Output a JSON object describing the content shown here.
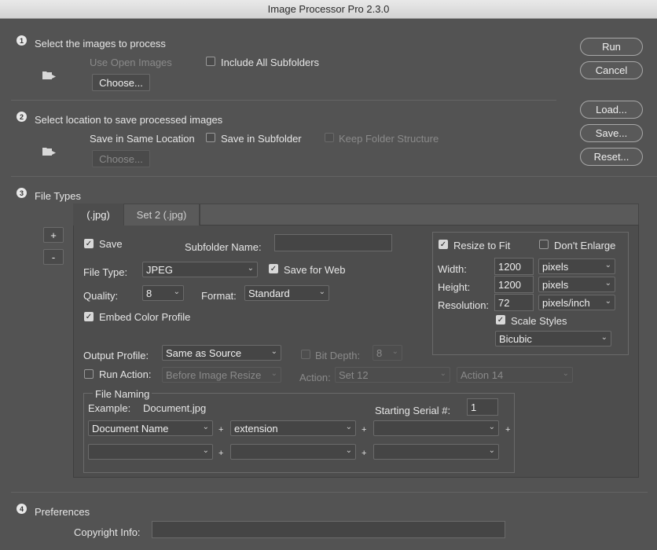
{
  "window": {
    "title": "Image Processor Pro 2.3.0"
  },
  "section1": {
    "num": "1",
    "title": "Select the images to process",
    "use_open_images": "Use Open Images",
    "include_subfolders": "Include All Subfolders",
    "choose": "Choose..."
  },
  "section2": {
    "num": "2",
    "title": "Select location to save processed images",
    "same_location": "Save in Same Location",
    "save_in_subfolder": "Save in Subfolder",
    "keep_structure": "Keep Folder Structure",
    "choose": "Choose..."
  },
  "buttons": {
    "run": "Run",
    "cancel": "Cancel",
    "load": "Load...",
    "save": "Save...",
    "reset": "Reset..."
  },
  "section3": {
    "num": "3",
    "title": "File Types",
    "plus": "+",
    "minus": "-",
    "tabs": [
      {
        "label": "(.jpg)"
      },
      {
        "label": "Set 2 (.jpg)"
      }
    ],
    "save_label": "Save",
    "subfolder_name_label": "Subfolder Name:",
    "subfolder_name_value": "",
    "file_type_label": "File Type:",
    "file_type_value": "JPEG",
    "save_for_web": "Save for Web",
    "quality_label": "Quality:",
    "quality_value": "8",
    "format_label": "Format:",
    "format_value": "Standard",
    "embed_color_profile": "Embed Color Profile",
    "resize": {
      "resize_to_fit": "Resize to Fit",
      "dont_enlarge": "Don't Enlarge",
      "width_label": "Width:",
      "width_value": "1200",
      "width_unit": "pixels",
      "height_label": "Height:",
      "height_value": "1200",
      "height_unit": "pixels",
      "resolution_label": "Resolution:",
      "resolution_value": "72",
      "resolution_unit": "pixels/inch",
      "scale_styles": "Scale Styles",
      "resample": "Bicubic"
    },
    "output_profile_label": "Output Profile:",
    "output_profile_value": "Same as Source",
    "bit_depth_label": "Bit Depth:",
    "bit_depth_value": "8",
    "run_action_label": "Run Action:",
    "run_action_timing": "Before Image Resize",
    "action_label": "Action:",
    "action_set": "Set 12",
    "action_name": "Action 14",
    "file_naming": {
      "title": "File Naming",
      "example_label": "Example:",
      "example_value": "Document.jpg",
      "serial_label": "Starting Serial #:",
      "serial_value": "1",
      "plus": "+",
      "row1": [
        "Document Name",
        "extension",
        ""
      ],
      "row2": [
        "",
        "",
        ""
      ]
    }
  },
  "section4": {
    "num": "4",
    "title": "Preferences",
    "copyright_label": "Copyright Info:",
    "copyright_value": ""
  }
}
